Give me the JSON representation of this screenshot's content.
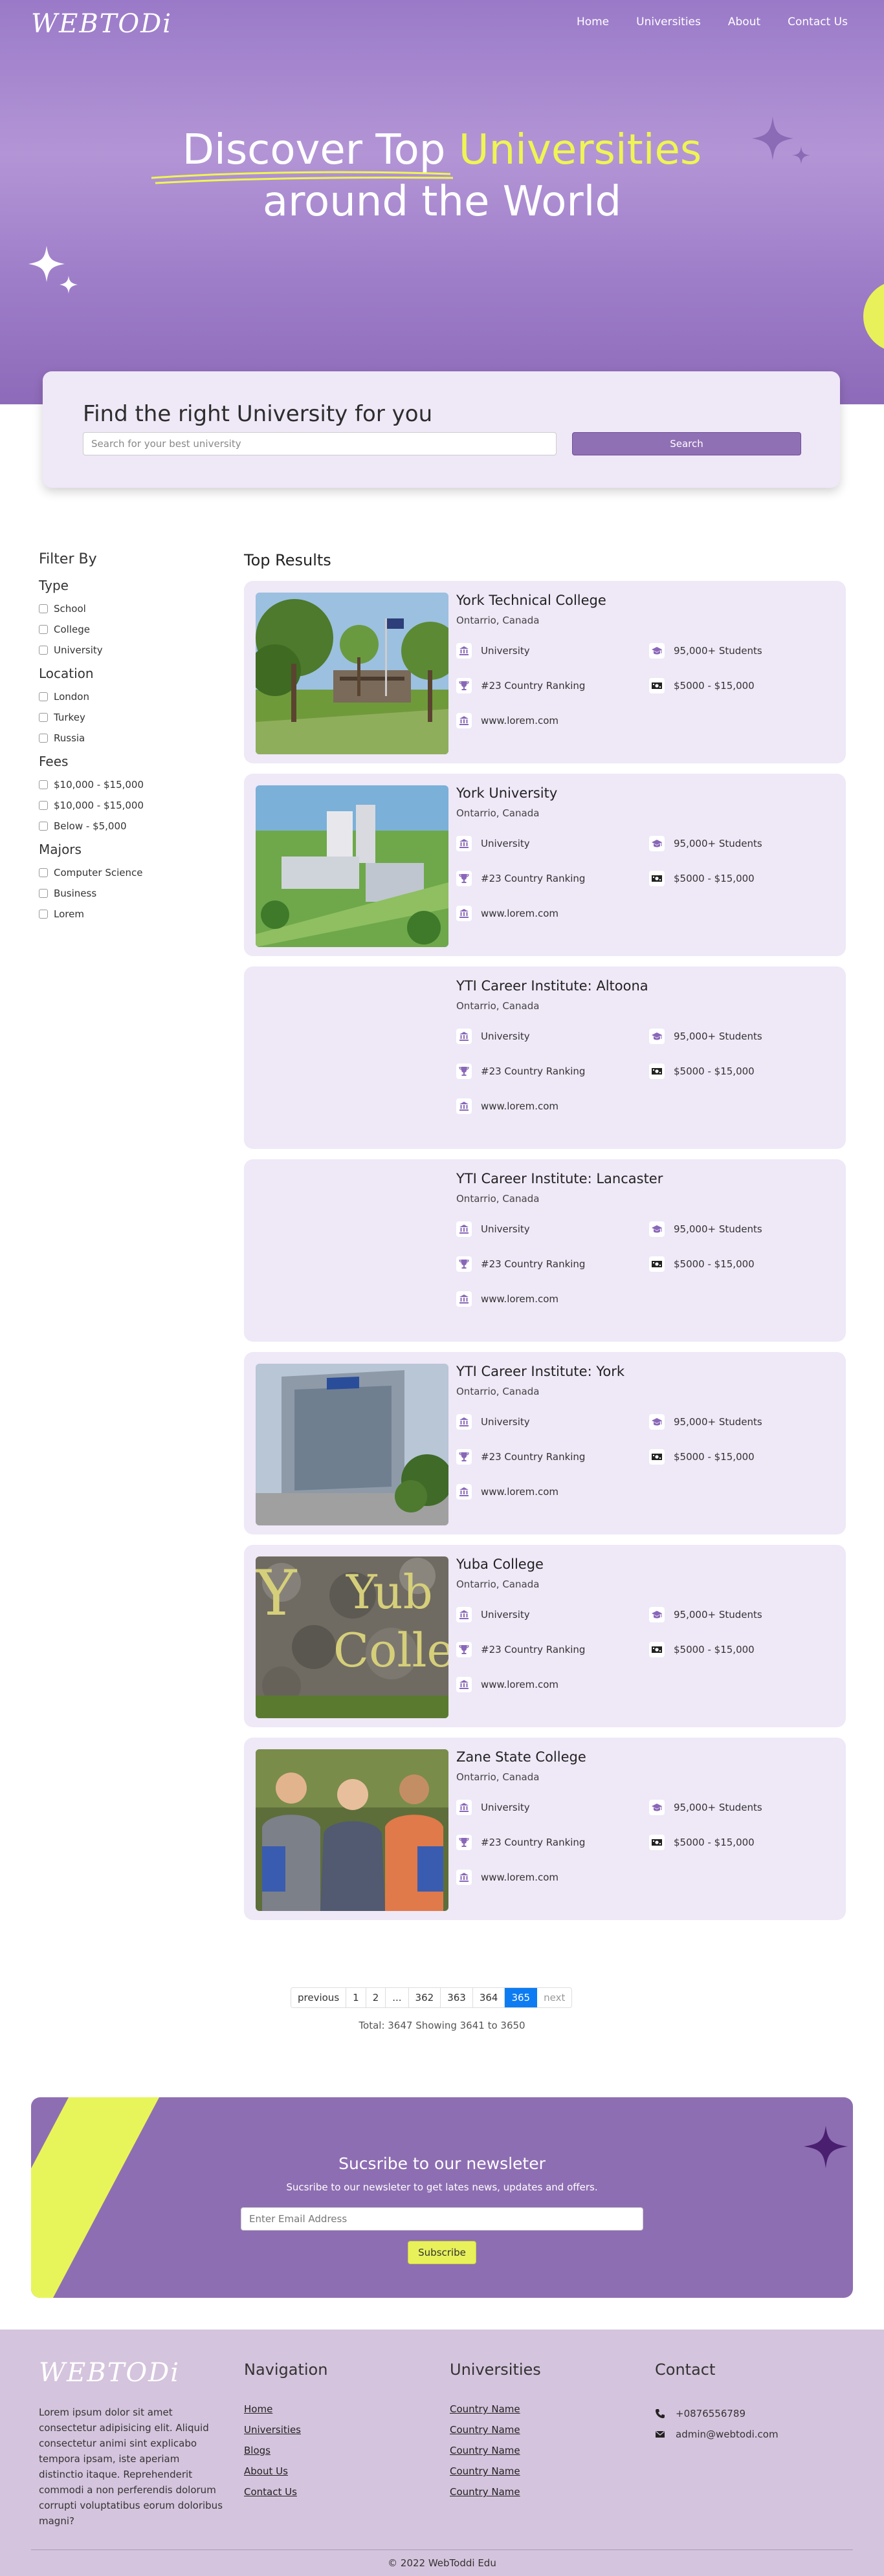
{
  "brand": {
    "logo": "WEBTODi",
    "footer_logo": "WEBTODi"
  },
  "nav": {
    "items": [
      "Home",
      "Universities",
      "About",
      "Contact Us"
    ]
  },
  "hero": {
    "title_part1": "Discover Top ",
    "title_highlight": "Universities",
    "title_line2": "around the World"
  },
  "search": {
    "heading": "Find the right University for you",
    "placeholder": "Search for your best university",
    "button": "Search"
  },
  "filters": {
    "title": "Filter By",
    "groups": [
      {
        "label": "Type",
        "options": [
          "School",
          "College",
          "University"
        ]
      },
      {
        "label": "Location",
        "options": [
          "London",
          "Turkey",
          "Russia"
        ]
      },
      {
        "label": "Fees",
        "options": [
          "$10,000 - $15,000",
          "$10,000 - $15,000",
          "Below - $5,000"
        ]
      },
      {
        "label": "Majors",
        "options": [
          "Computer Science",
          "Business",
          "Lorem"
        ]
      }
    ]
  },
  "results": {
    "title": "Top Results",
    "items": [
      {
        "name": "York Technical College",
        "location": "Ontarrio, Canada",
        "type": "University",
        "students": "95,000+ Students",
        "ranking": "#23 Country Ranking",
        "fees": "$5000 - $15,000",
        "website": "www.lorem.com",
        "image": "campus-trees"
      },
      {
        "name": "York University",
        "location": "Ontarrio, Canada",
        "type": "University",
        "students": "95,000+ Students",
        "ranking": "#23 Country Ranking",
        "fees": "$5000 - $15,000",
        "website": "www.lorem.com",
        "image": "campus-aerial"
      },
      {
        "name": "YTI Career Institute: Altoona",
        "location": "Ontarrio, Canada",
        "type": "University",
        "students": "95,000+ Students",
        "ranking": "#23 Country Ranking",
        "fees": "$5000 - $15,000",
        "website": "www.lorem.com",
        "image": "none"
      },
      {
        "name": "YTI Career Institute: Lancaster",
        "location": "Ontarrio, Canada",
        "type": "University",
        "students": "95,000+ Students",
        "ranking": "#23 Country Ranking",
        "fees": "$5000 - $15,000",
        "website": "www.lorem.com",
        "image": "none"
      },
      {
        "name": "YTI Career Institute: York",
        "location": "Ontarrio, Canada",
        "type": "University",
        "students": "95,000+ Students",
        "ranking": "#23 Country Ranking",
        "fees": "$5000 - $15,000",
        "website": "www.lorem.com",
        "image": "building-yti"
      },
      {
        "name": "Yuba College",
        "location": "Ontarrio, Canada",
        "type": "University",
        "students": "95,000+ Students",
        "ranking": "#23 Country Ranking",
        "fees": "$5000 - $15,000",
        "website": "www.lorem.com",
        "image": "stone-sign"
      },
      {
        "name": "Zane State College",
        "location": "Ontarrio, Canada",
        "type": "University",
        "students": "95,000+ Students",
        "ranking": "#23 Country Ranking",
        "fees": "$5000 - $15,000",
        "website": "www.lorem.com",
        "image": "students"
      }
    ]
  },
  "pagination": {
    "items": [
      "previous",
      "1",
      "2",
      "...",
      "362",
      "363",
      "364",
      "365",
      "next"
    ],
    "active": "365",
    "summary": "Total: 3647 Showing 3641 to 3650"
  },
  "newsletter": {
    "title": "Sucsribe to our newsleter",
    "subtitle": "Sucsribe to our newsleter to get lates news, updates and offers.",
    "placeholder": "Enter Email Address",
    "button": "Subscribe"
  },
  "footer": {
    "description": "Lorem ipsum dolor sit amet consectetur adipisicing elit. Aliquid consectetur animi sint explicabo tempora ipsam, iste aperiam distinctio itaque. Reprehenderit commodi a non perferendis dolorum corrupti voluptatibus eorum doloribus magni?",
    "nav_title": "Navigation",
    "nav_links": [
      "Home",
      "Universities",
      "Blogs",
      "About Us",
      "Contact Us"
    ],
    "uni_title": "Universities",
    "uni_links": [
      "Country Name",
      "Country Name",
      "Country Name",
      "Country Name",
      "Country Name"
    ],
    "contact_title": "Contact",
    "phone": "+0876556789",
    "email": "admin@webtodi.com",
    "copyright": "© 2022 WebToddi Edu"
  },
  "colors": {
    "primary": "#9070b4",
    "accent": "#e8f15a",
    "card_bg": "#efe8f7",
    "footer_bg": "#d5c4dd",
    "active_page": "#0d7cf2"
  }
}
